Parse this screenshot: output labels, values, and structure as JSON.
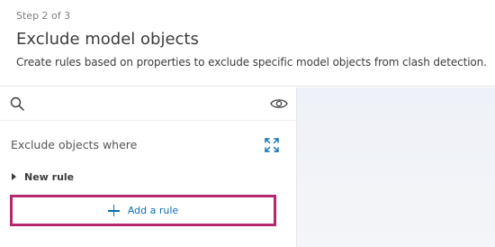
{
  "header": {
    "step": "Step 2 of 3",
    "title": "Exclude model objects",
    "subtitle": "Create rules based on properties to exclude specific model objects from clash detection."
  },
  "search": {
    "placeholder": "",
    "value": "",
    "icon": "search-icon",
    "visibility_icon": "eye-icon"
  },
  "rules": {
    "section_title": "Exclude objects where",
    "expand_icon": "expand-icon",
    "items": [
      {
        "label": "New rule",
        "expanded": false
      }
    ],
    "add_rule_label": "Add a rule"
  },
  "colors": {
    "accent_link": "#0a6fb3",
    "highlight_border": "#b5286d"
  }
}
